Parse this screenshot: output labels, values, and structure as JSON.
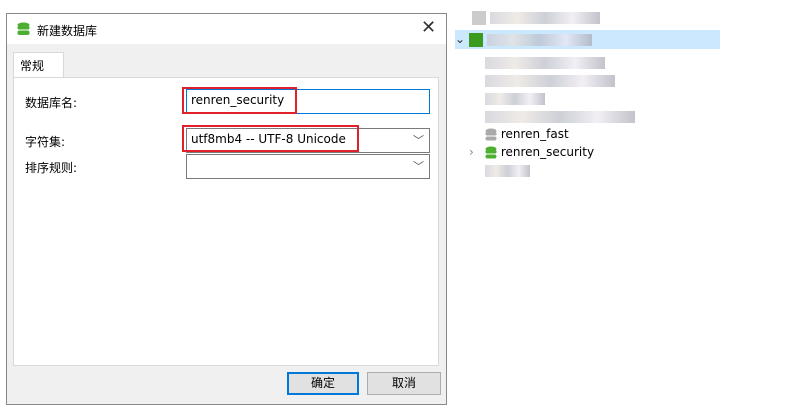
{
  "dialog": {
    "title": "新建数据库",
    "tab": "常规",
    "labels": {
      "name": "数据库名:",
      "charset": "字符集:",
      "collation": "排序规则:"
    },
    "name_value": "renren_security",
    "charset_value": "utf8mb4 -- UTF-8 Unicode",
    "collation_value": "",
    "ok_label": "确定",
    "cancel_label": "取消"
  },
  "tree": {
    "items": [
      {
        "label": "renren_fast"
      },
      {
        "label": "renren_security"
      }
    ]
  },
  "colors": {
    "db_green": "#4caf32",
    "highlight": "#e0202a",
    "selected_row": "#cce8ff",
    "focus": "#0078d7"
  }
}
